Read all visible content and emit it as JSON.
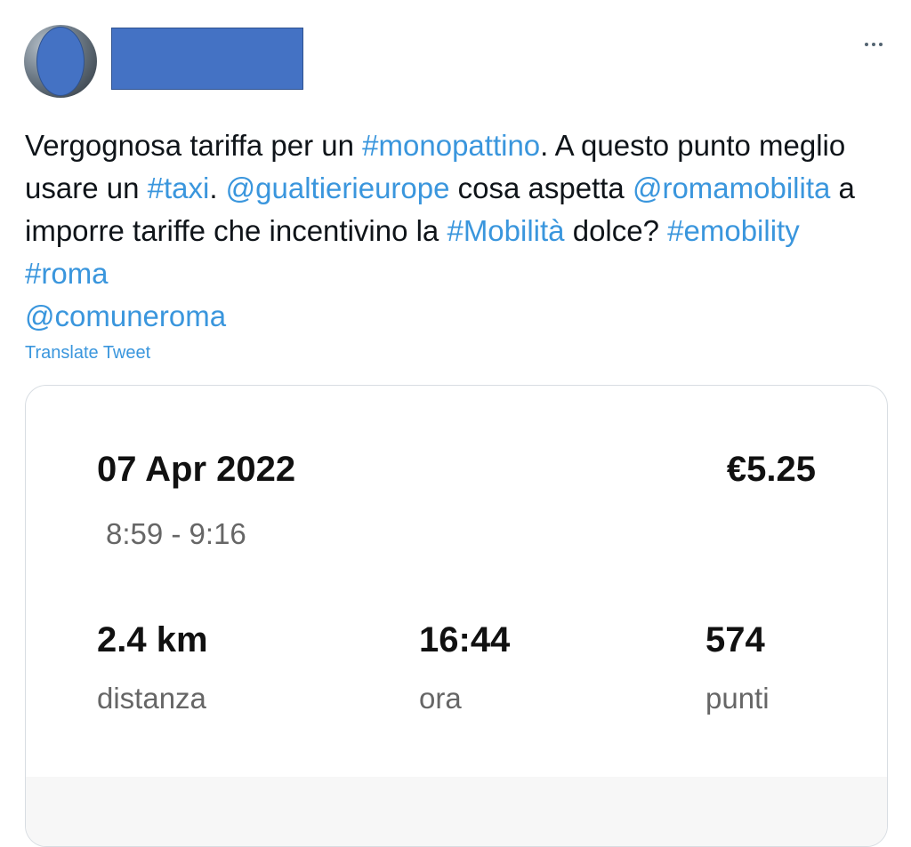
{
  "author": {
    "avatar_icon": "avatar-redacted",
    "name_redacted": true
  },
  "tweet": {
    "segments": [
      {
        "text": "Vergognosa tariffa per un ",
        "type": "text"
      },
      {
        "text": "#monopattino",
        "type": "link"
      },
      {
        "text": ". A questo punto meglio usare un ",
        "type": "text"
      },
      {
        "text": "#taxi",
        "type": "link"
      },
      {
        "text": ". ",
        "type": "text"
      },
      {
        "text": "@gualtierieurope",
        "type": "link"
      },
      {
        "text": " cosa aspetta ",
        "type": "text"
      },
      {
        "text": "@romamobilita",
        "type": "link"
      },
      {
        "text": " a imporre tariffe che incentivino la ",
        "type": "text"
      },
      {
        "text": "#Mobilità",
        "type": "link"
      },
      {
        "text": " dolce? ",
        "type": "text"
      },
      {
        "text": "#emobility",
        "type": "link"
      },
      {
        "text": " ",
        "type": "text"
      },
      {
        "text": "#roma",
        "type": "link"
      },
      {
        "text": " ",
        "type": "text"
      },
      {
        "text": "@comuneroma",
        "type": "link"
      }
    ],
    "translate_label": "Translate Tweet"
  },
  "ride_card": {
    "date": "07 Apr 2022",
    "price": "€5.25",
    "time_range": "8:59 -  9:16",
    "stats": {
      "distance_value": "2.4 km",
      "distance_label": "distanza",
      "time_value": "16:44",
      "time_label": "ora",
      "points_value": "574",
      "points_label": "punti"
    }
  },
  "colors": {
    "link": "#3a96dd",
    "redaction": "#4472c4",
    "text": "#0f1419"
  }
}
